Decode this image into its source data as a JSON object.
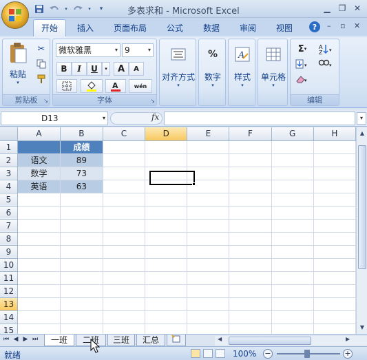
{
  "window": {
    "title": "多表求和 - Microsoft Excel"
  },
  "quick_access": {
    "save_icon": "save-icon",
    "undo_icon": "undo-icon",
    "redo_icon": "redo-icon",
    "customize_icon": "customize-icon"
  },
  "ribbon_tabs": [
    "开始",
    "插入",
    "页面布局",
    "公式",
    "数据",
    "审阅",
    "视图"
  ],
  "ribbon": {
    "clipboard": {
      "paste_label": "粘贴",
      "group_label": "剪贴板"
    },
    "font": {
      "font_name": "微软雅黑",
      "font_size": "9",
      "group_label": "字体",
      "bold": "B",
      "italic": "I",
      "underline": "U",
      "grow": "A",
      "shrink": "A",
      "phonetic": "wén"
    },
    "alignment": {
      "label": "对齐方式"
    },
    "number": {
      "label": "数字",
      "icon_text": "%"
    },
    "styles": {
      "label": "样式"
    },
    "cells": {
      "label": "单元格"
    },
    "editing": {
      "group_label": "编辑",
      "sum_icon": "Σ"
    }
  },
  "formula_bar": {
    "name_box": "D13",
    "fx": "fx",
    "formula": ""
  },
  "grid": {
    "columns": [
      "A",
      "B",
      "C",
      "D",
      "E",
      "F",
      "G",
      "H"
    ],
    "rows": [
      "1",
      "2",
      "3",
      "4",
      "5",
      "6",
      "7",
      "8",
      "9",
      "10",
      "11",
      "12",
      "13",
      "14",
      "15"
    ],
    "selected_column": "D",
    "selected_row": "13",
    "cells": {
      "B1": "成绩",
      "A2": "语文",
      "B2": "89",
      "A3": "数学",
      "B3": "73",
      "A4": "英语",
      "B4": "63"
    }
  },
  "sheet_tabs": [
    "一班",
    "二班",
    "三班",
    "汇总"
  ],
  "active_sheet": "一班",
  "status": {
    "ready": "就绪",
    "zoom": "100%",
    "zoom_out": "−",
    "zoom_in": "+"
  },
  "colors": {
    "header_blue": "#4f81bd",
    "band_dark": "#b8cce4",
    "band_light": "#dbe5f1",
    "selected_header": "#f8c85e"
  }
}
